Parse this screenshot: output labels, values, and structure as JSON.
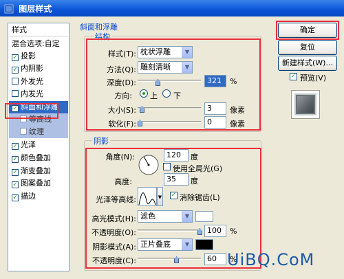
{
  "window": {
    "title": "图层样式"
  },
  "styles_list": {
    "header": "样式",
    "blend_options": "混合选项:自定",
    "items": [
      {
        "label": "投影",
        "checked": true
      },
      {
        "label": "内阴影",
        "checked": true
      },
      {
        "label": "外发光",
        "checked": false
      },
      {
        "label": "内发光",
        "checked": false
      },
      {
        "label": "斜面和浮雕",
        "checked": true,
        "selected": true
      },
      {
        "label": "等高线",
        "checked": false,
        "sub": true
      },
      {
        "label": "纹理",
        "checked": false,
        "sub": true
      },
      {
        "label": "光泽",
        "checked": true
      },
      {
        "label": "颜色叠加",
        "checked": true
      },
      {
        "label": "渐变叠加",
        "checked": true
      },
      {
        "label": "图案叠加",
        "checked": true
      },
      {
        "label": "描边",
        "checked": true
      }
    ]
  },
  "bevel": {
    "section_title": "斜面和浮雕",
    "structure": {
      "title": "结构",
      "style_label": "样式(T):",
      "style_value": "枕状浮雕",
      "technique_label": "方法(Q):",
      "technique_value": "雕刻清晰",
      "depth_label": "深度(D):",
      "depth_value": "321",
      "depth_unit": "%",
      "direction_label": "方向:",
      "direction_up": "上",
      "direction_down": "下",
      "size_label": "大小(S):",
      "size_value": "3",
      "size_unit": "像素",
      "soften_label": "软化(F):",
      "soften_value": "0",
      "soften_unit": "像素"
    },
    "shading": {
      "title": "阴影",
      "angle_label": "角度(N):",
      "angle_value": "120",
      "angle_unit": "度",
      "global_light_label": "使用全局光(G)",
      "altitude_label": "高度:",
      "altitude_value": "35",
      "altitude_unit": "度",
      "gloss_contour_label": "光泽等高线:",
      "anti_alias_label": "消除锯齿(L)",
      "highlight_mode_label": "高光模式(H):",
      "highlight_mode_value": "滤色",
      "highlight_opacity_label": "不透明度(O):",
      "highlight_opacity_value": "100",
      "highlight_opacity_unit": "%",
      "shadow_mode_label": "阴影模式(A):",
      "shadow_mode_value": "正片叠底",
      "shadow_opacity_label": "不透明度(C):",
      "shadow_opacity_value": "60",
      "shadow_opacity_unit": "%",
      "highlight_color": "#ffffff",
      "shadow_color": "#000000"
    }
  },
  "buttons": {
    "ok": "确定",
    "reset": "复位",
    "new_style": "新建样式(W)...",
    "preview": "预览(V)"
  },
  "watermark": "UiBQ.CoM",
  "colors": {
    "accent_red": "#e8303c",
    "selection": "#316ac5"
  }
}
